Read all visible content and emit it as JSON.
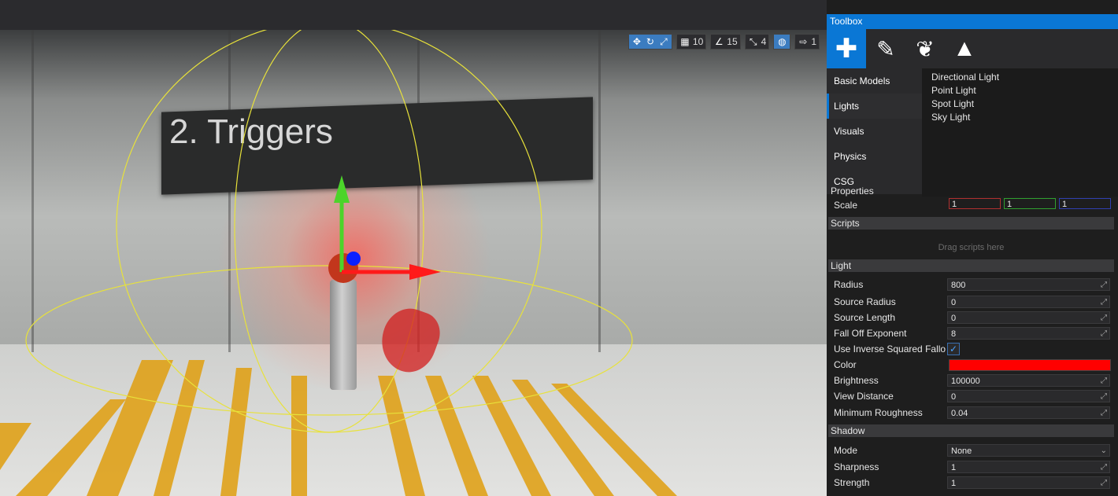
{
  "viewport": {
    "sign_text": "2. Triggers",
    "toolbar": [
      {
        "name": "translate-gizmo",
        "value": ""
      },
      {
        "name": "grid-snap",
        "value": "10"
      },
      {
        "name": "rotate-snap",
        "value": "15"
      },
      {
        "name": "scale-snap",
        "value": "4"
      },
      {
        "name": "camera-speed",
        "value": "1"
      }
    ]
  },
  "toolbox": {
    "title": "Toolbox",
    "tabs": [
      "add",
      "paint",
      "foliage",
      "terrain"
    ],
    "categories": [
      "Basic Models",
      "Lights",
      "Visuals",
      "Physics",
      "CSG"
    ],
    "active_category": "Lights",
    "items": [
      "Directional Light",
      "Point Light",
      "Spot Light",
      "Sky Light"
    ]
  },
  "properties": {
    "title": "Properties",
    "scale": {
      "label": "Scale",
      "x": "1",
      "y": "1",
      "z": "1"
    },
    "scripts": {
      "title": "Scripts",
      "hint": "Drag scripts here"
    },
    "light": {
      "title": "Light",
      "rows": [
        {
          "label": "Radius",
          "value": "800"
        },
        {
          "label": "Source Radius",
          "value": "0"
        },
        {
          "label": "Source Length",
          "value": "0"
        },
        {
          "label": "Fall Off Exponent",
          "value": "8"
        }
      ],
      "inverse_label": "Use Inverse Squared Falloff",
      "color_label": "Color",
      "color_value": "#ff0000",
      "rows2": [
        {
          "label": "Brightness",
          "value": "100000"
        },
        {
          "label": "View Distance",
          "value": "0"
        },
        {
          "label": "Minimum Roughness",
          "value": "0.04"
        }
      ]
    },
    "shadow": {
      "title": "Shadow",
      "mode_label": "Mode",
      "mode_value": "None",
      "rows": [
        {
          "label": "Sharpness",
          "value": "1"
        },
        {
          "label": "Strength",
          "value": "1"
        }
      ]
    }
  },
  "colors": {
    "accent": "#0a77d5",
    "gizmo_x": "#ff1a1a",
    "gizmo_y": "#4cd42a",
    "gizmo_z": "#0a20ff",
    "light_radius": "#e8e23a"
  }
}
